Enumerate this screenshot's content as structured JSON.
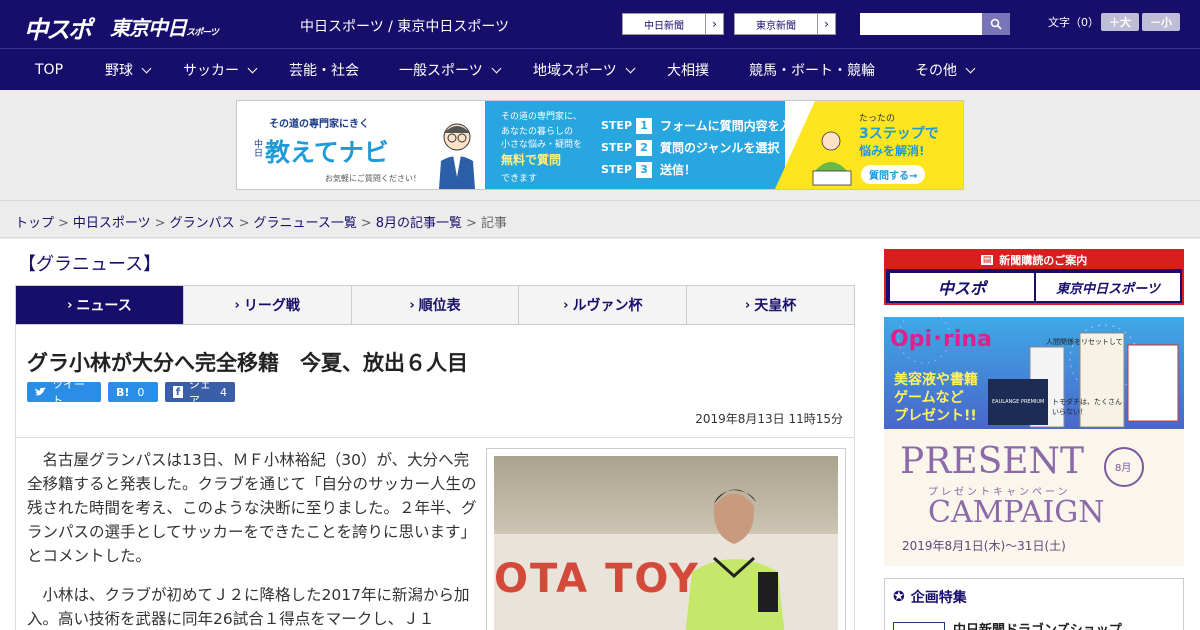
{
  "header": {
    "logo_main": "中スポ",
    "logo_tokyo": "東京中日",
    "logo_tokyo_small": "スポーツ",
    "site_names": "中日スポーツ / 東京中日スポーツ",
    "ext_links": [
      {
        "label": "中日新聞"
      },
      {
        "label": "東京新聞"
      }
    ],
    "search": {
      "value": "",
      "placeholder": ""
    },
    "font_size_label": "文字（0）",
    "font_plus": "＋大",
    "font_minus": "－小"
  },
  "nav": {
    "items": [
      {
        "label": "TOP",
        "dropdown": false
      },
      {
        "label": "野球",
        "dropdown": true
      },
      {
        "label": "サッカー",
        "dropdown": true
      },
      {
        "label": "芸能・社会",
        "dropdown": false
      },
      {
        "label": "一般スポーツ",
        "dropdown": true
      },
      {
        "label": "地域スポーツ",
        "dropdown": true
      },
      {
        "label": "大相撲",
        "dropdown": false
      },
      {
        "label": "競馬・ボート・競輪",
        "dropdown": false
      },
      {
        "label": "その他",
        "dropdown": true
      }
    ]
  },
  "banner": {
    "tagline": "その道の専門家にきく",
    "brand_prefix": "中日",
    "brand": "教えてナビ",
    "note": "お気軽にご質問ください！",
    "mid_1": "その道の専門家に、",
    "mid_2": "あなたの暮らしの",
    "mid_3": "小さな悩み・疑問を",
    "mid_free": "無料で質問",
    "mid_4": "できます",
    "step_word": "STEP",
    "steps": [
      {
        "num": "1",
        "text": "フォームに質問内容を入力"
      },
      {
        "num": "2",
        "text": "質問のジャンルを選択"
      },
      {
        "num": "3",
        "text": "送信！"
      }
    ],
    "yellow_1": "たったの",
    "yellow_2": "3ステップで",
    "yellow_3": "悩みを解消!",
    "cta": "質問する→",
    "colors": {
      "blue": "#28a6e0",
      "yellow": "#ffe51f"
    }
  },
  "breadcrumb": {
    "items": [
      "トップ",
      "中日スポーツ",
      "グランパス",
      "グラニュース一覧",
      "8月の記事一覧"
    ],
    "current": "記事",
    "separator": ">"
  },
  "section_title": "【グラニュース】",
  "tabs": [
    "ニュース",
    "リーグ戦",
    "順位表",
    "ルヴァン杯",
    "天皇杯"
  ],
  "article": {
    "headline": "グラ小林が大分へ完全移籍　今夏、放出６人目",
    "share": {
      "tweet": "ツイート",
      "hatena": "B!",
      "hatena_count": "0",
      "facebook": "シェア",
      "facebook_count": "4"
    },
    "date": "2019年8月13日 11時15分",
    "paragraphs": [
      "名古屋グランパスは13日、ＭＦ小林裕紀（30）が、大分へ完全移籍すると発表した。クラブを通じて「自分のサッカー人生の残された時間を考え、このような決断に至りました。２年半、グランパスの選手としてサッカーをできたことを誇りに思います」とコメントした。",
      "小林は、クラブが初めてＪ２に降格した2017年に新潟から加入。高い技術を武器に同年26試合１得点をマークし、Ｊ１"
    ],
    "photo_sign_text": "OTA TOY"
  },
  "sidebar": {
    "subscribe_title": "新聞購読のご案内",
    "sub_logos": [
      "中スポ",
      "東京中日スポーツ"
    ],
    "campaign": {
      "brand": "Opi･rina",
      "left_lines": [
        "美容液や書籍",
        "ゲームなど",
        "プレゼント!!"
      ],
      "month": "8月",
      "title_1": "PRESENT",
      "title_kana": "プレゼントキャンペーン",
      "title_2": "CAMPAIGN",
      "dates": "2019年8月1日(木)〜31日(土)",
      "book_title": "人間関係をリセットして",
      "book_sub": "トモダチは、たくさんいらない！",
      "product": "EAULANGE PREMIUM"
    },
    "special_title": "企画特集",
    "special_item": "中日新聞ドラゴンズショップ"
  }
}
